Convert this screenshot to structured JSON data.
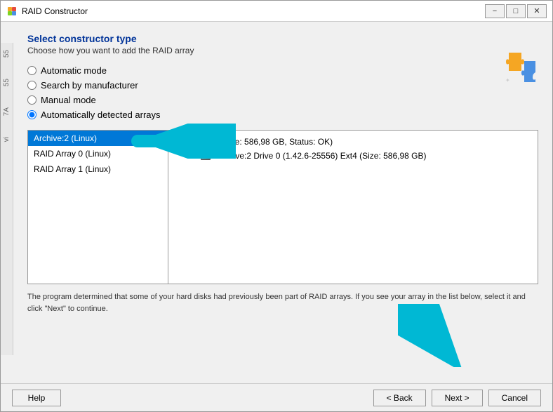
{
  "window": {
    "title": "RAID Constructor",
    "minimize_label": "−",
    "restore_label": "□",
    "close_label": "✕"
  },
  "header": {
    "title": "Select constructor type",
    "subtitle": "Choose how you want to add the RAID array"
  },
  "radio_options": [
    {
      "id": "automatic",
      "label": "Automatic mode",
      "checked": false
    },
    {
      "id": "search",
      "label": "Search by manufacturer",
      "checked": false
    },
    {
      "id": "manual",
      "label": "Manual mode",
      "checked": false
    },
    {
      "id": "auto_detected",
      "label": "Automatically detected arrays",
      "checked": true
    }
  ],
  "left_list": {
    "items": [
      {
        "label": "Archive:2 (Linux)",
        "selected": true
      },
      {
        "label": "RAID Array 0 (Linux)",
        "selected": false
      },
      {
        "label": "RAID Array 1 (Linux)",
        "selected": false
      }
    ]
  },
  "right_panel": {
    "items": [
      {
        "level": 0,
        "label": "RAID 5 (Size: 586,98 GB, Status: OK)",
        "type": "raid"
      },
      {
        "level": 1,
        "label": "Archive:2 Drive 0 (1.42.6-25556) Ext4 (Size: 586,98 GB)",
        "type": "drive"
      }
    ]
  },
  "info_text": "The program determined that some of your hard disks had previously been part of RAID arrays. If you see your array in the list below, select it and click \"Next\" to continue.",
  "footer": {
    "help_label": "Help",
    "back_label": "< Back",
    "next_label": "Next >",
    "cancel_label": "Cancel"
  },
  "sidebar": {
    "labels": [
      "55",
      "55",
      "7A",
      "vi"
    ]
  }
}
